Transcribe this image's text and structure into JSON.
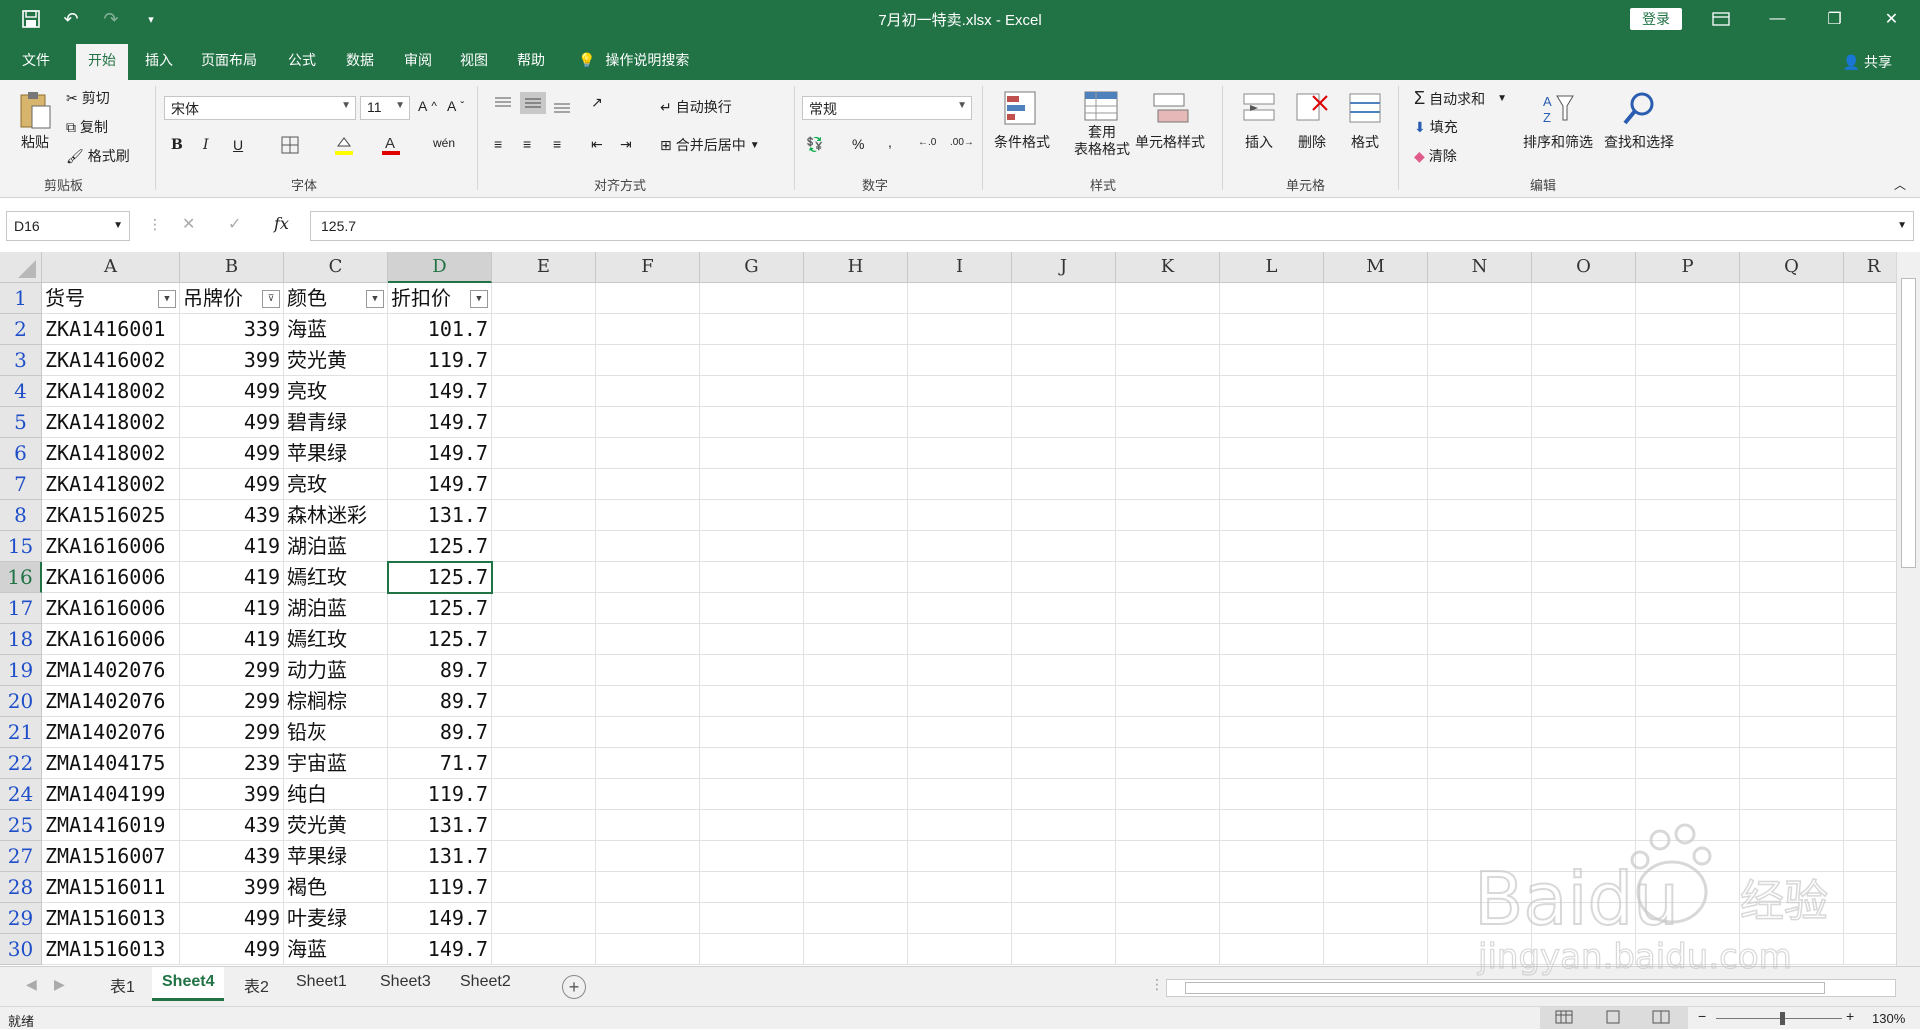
{
  "window": {
    "title": "7月初一特卖.xlsx  -  Excel",
    "login": "登录"
  },
  "tabs": [
    "文件",
    "开始",
    "插入",
    "页面布局",
    "公式",
    "数据",
    "审阅",
    "视图",
    "帮助"
  ],
  "tell_me": "操作说明搜索",
  "share": "共享",
  "ribbon": {
    "clipboard": {
      "paste": "粘贴",
      "cut": "剪切",
      "copy": "复制",
      "format_painter": "格式刷",
      "label": "剪贴板"
    },
    "font": {
      "name": "宋体",
      "size": "11",
      "label": "字体",
      "bold": "B",
      "italic": "I",
      "underline": "U"
    },
    "alignment": {
      "wrap": "自动换行",
      "merge": "合并后居中",
      "label": "对齐方式"
    },
    "number": {
      "format": "常规",
      "label": "数字"
    },
    "styles": {
      "conditional": "条件格式",
      "table_1": "套用",
      "table_2": "表格格式",
      "cell_styles": "单元格样式",
      "label": "样式"
    },
    "cells": {
      "insert": "插入",
      "delete": "删除",
      "format": "格式",
      "label": "单元格"
    },
    "editing": {
      "autosum": "自动求和",
      "fill": "填充",
      "clear": "清除",
      "sort": "排序和筛选",
      "find": "查找和选择",
      "label": "编辑"
    }
  },
  "formula_bar": {
    "name_box": "D16",
    "fx": "fx",
    "value": "125.7"
  },
  "columns": [
    "A",
    "B",
    "C",
    "D",
    "E",
    "F",
    "G",
    "H",
    "I",
    "J",
    "K",
    "L",
    "M",
    "N",
    "O",
    "P",
    "Q",
    "R"
  ],
  "header_row": {
    "row": "1",
    "a": "货号",
    "b": "吊牌价",
    "c": "颜色",
    "d": "折扣价"
  },
  "rows": [
    {
      "row": "2",
      "a": "ZKA1416001",
      "b": "339",
      "c": "海蓝",
      "d": "101.7"
    },
    {
      "row": "3",
      "a": "ZKA1416002",
      "b": "399",
      "c": "荧光黄",
      "d": "119.7"
    },
    {
      "row": "4",
      "a": "ZKA1418002",
      "b": "499",
      "c": "亮玫",
      "d": "149.7"
    },
    {
      "row": "5",
      "a": "ZKA1418002",
      "b": "499",
      "c": "碧青绿",
      "d": "149.7"
    },
    {
      "row": "6",
      "a": "ZKA1418002",
      "b": "499",
      "c": "苹果绿",
      "d": "149.7"
    },
    {
      "row": "7",
      "a": "ZKA1418002",
      "b": "499",
      "c": "亮玫",
      "d": "149.7"
    },
    {
      "row": "8",
      "a": "ZKA1516025",
      "b": "439",
      "c": "森林迷彩",
      "d": "131.7"
    },
    {
      "row": "15",
      "a": "ZKA1616006",
      "b": "419",
      "c": "湖泊蓝",
      "d": "125.7"
    },
    {
      "row": "16",
      "a": "ZKA1616006",
      "b": "419",
      "c": "嫣红玫",
      "d": "125.7"
    },
    {
      "row": "17",
      "a": "ZKA1616006",
      "b": "419",
      "c": "湖泊蓝",
      "d": "125.7"
    },
    {
      "row": "18",
      "a": "ZKA1616006",
      "b": "419",
      "c": "嫣红玫",
      "d": "125.7"
    },
    {
      "row": "19",
      "a": "ZMA1402076",
      "b": "299",
      "c": "动力蓝",
      "d": "89.7"
    },
    {
      "row": "20",
      "a": "ZMA1402076",
      "b": "299",
      "c": "棕榈棕",
      "d": "89.7"
    },
    {
      "row": "21",
      "a": "ZMA1402076",
      "b": "299",
      "c": "铅灰",
      "d": "89.7"
    },
    {
      "row": "22",
      "a": "ZMA1404175",
      "b": "239",
      "c": "宇宙蓝",
      "d": "71.7"
    },
    {
      "row": "24",
      "a": "ZMA1404199",
      "b": "399",
      "c": "纯白",
      "d": "119.7"
    },
    {
      "row": "25",
      "a": "ZMA1416019",
      "b": "439",
      "c": "荧光黄",
      "d": "131.7"
    },
    {
      "row": "27",
      "a": "ZMA1516007",
      "b": "439",
      "c": "苹果绿",
      "d": "131.7"
    },
    {
      "row": "28",
      "a": "ZMA1516011",
      "b": "399",
      "c": "褐色",
      "d": "119.7"
    },
    {
      "row": "29",
      "a": "ZMA1516013",
      "b": "499",
      "c": "叶麦绿",
      "d": "149.7"
    },
    {
      "row": "30",
      "a": "ZMA1516013",
      "b": "499",
      "c": "海蓝",
      "d": "149.7"
    }
  ],
  "sheets": [
    "表1",
    "Sheet4",
    "表2",
    "Sheet1",
    "Sheet3",
    "Sheet2"
  ],
  "active_sheet": "Sheet4",
  "status": {
    "ready": "就绪",
    "zoom": "130%"
  },
  "watermark": {
    "brand": "Baidu",
    "cn": "经验",
    "url": "jingyan.baidu.com"
  },
  "colors": {
    "accent": "#217346",
    "row_number": "#1f4fc8"
  }
}
